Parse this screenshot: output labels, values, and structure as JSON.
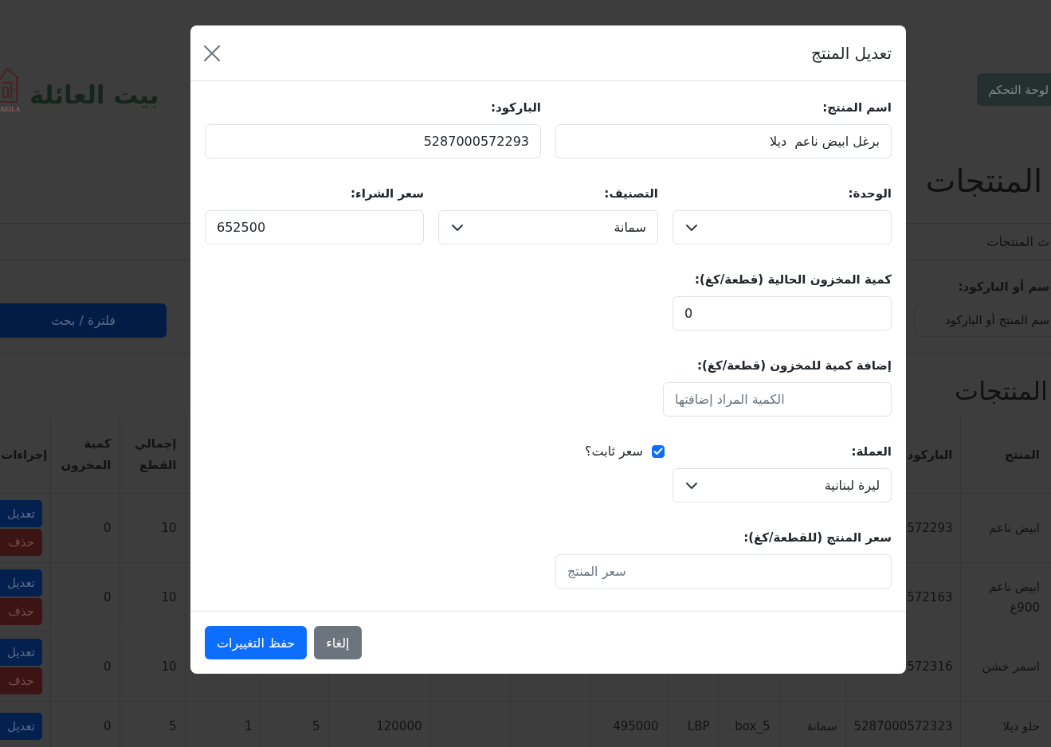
{
  "navbar": {
    "logo_text": "AEILA",
    "brand": "بيت العائلة",
    "dashboard_button": "لوحة التحكم"
  },
  "page_title": "المنتجات",
  "search_card": {
    "header": "ث المنتجات",
    "search_field": {
      "label": "سم أو الباركود:",
      "placeholder": "سم المنتج أو الباركود"
    },
    "filter_button": "فلترة / بحث"
  },
  "products_heading": "المنتجات",
  "table": {
    "columns": {
      "product": "المنتج",
      "barcode": "الباركود",
      "total_pieces": "إجمالي القطع",
      "stock": "كمية المخزون",
      "actions": "إجراءات"
    },
    "rows": [
      {
        "product": "ابيض ناعم",
        "barcode": "572293",
        "total_pieces": "10",
        "stock": "0",
        "actions": [
          {
            "kind": "edit",
            "label": "تعديل"
          },
          {
            "kind": "delete",
            "label": "حذف"
          }
        ]
      },
      {
        "product": "ابيض ناعم 900غ",
        "barcode": "572163",
        "total_pieces": "10",
        "stock": "0",
        "actions": [
          {
            "kind": "edit",
            "label": "تعديل"
          },
          {
            "kind": "delete",
            "label": "حذف"
          }
        ]
      },
      {
        "product": "اسمر خشن",
        "barcode": "572316",
        "total_pieces": "10",
        "stock": "0",
        "actions": [
          {
            "kind": "edit",
            "label": "تعديل"
          },
          {
            "kind": "delete",
            "label": "حذف"
          }
        ]
      },
      {
        "product": "حلو ديلا",
        "barcode": "5287000572323",
        "column_3": "سمانة",
        "column_4": "box_5",
        "column_5": "LBP",
        "column_6": "495000",
        "column_9": "120000",
        "column_10": "5",
        "column_11": "1",
        "total_pieces": "5",
        "stock": "0",
        "actions": [
          {
            "kind": "edit",
            "label": "تعديل"
          }
        ]
      }
    ]
  },
  "modal": {
    "title": "تعديل المنتج",
    "rows": [
      {
        "fields": [
          {
            "kind": "text",
            "label": "اسم المنتج:",
            "value": "برغل ابيض ناعم  ديلا"
          },
          {
            "kind": "text",
            "label": "الباركود:",
            "value": "5287000572293"
          }
        ]
      },
      {
        "fields": [
          {
            "kind": "select",
            "label": "الوحدة:"
          },
          {
            "kind": "select",
            "label": "التصنيف:",
            "value": "سمانة"
          },
          {
            "kind": "number",
            "label": "سعر الشراء:",
            "value": "652500"
          }
        ]
      },
      {
        "fields": [
          {
            "kind": "number",
            "label": "كمية المخزون الحالية (قطعة/كغ):",
            "value": "0"
          }
        ]
      },
      {
        "fields": [
          {
            "kind": "number",
            "label": "إضافة كمية للمخزون (قطعة/كغ):",
            "placeholder": "الكمية المراد إضافتها"
          }
        ]
      },
      {
        "fields": [
          {
            "kind": "select",
            "label": "العملة:",
            "value": "ليرة لبنانية"
          },
          {
            "kind": "checkbox",
            "label": "سعر ثابت؟",
            "checked": true
          }
        ]
      },
      {
        "fields": [
          {
            "kind": "number",
            "label": "سعر المنتج (للقطعة/كغ):",
            "placeholder": "سعر المنتج"
          }
        ]
      }
    ],
    "buttons": [
      {
        "kind": "secondary",
        "label": "إلغاء"
      },
      {
        "kind": "primary",
        "label": "حفظ التغييرات"
      }
    ]
  }
}
